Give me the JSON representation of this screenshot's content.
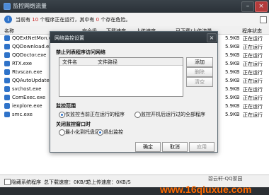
{
  "window": {
    "title": "监控网络流量"
  },
  "infobar": {
    "prefix": "当前有",
    "count_running": "10",
    "middle": "个程序正在运行，其中有",
    "count_danger": "0",
    "suffix": "个存在危险。"
  },
  "table": {
    "headers": [
      "名称",
      "安全级",
      "下载速度",
      "上传速度",
      "已下载/上传流量",
      "程序状态"
    ],
    "rows": [
      {
        "name": "QQExtNetMon.exe",
        "traffic": "5.9KB",
        "status": "正在运行"
      },
      {
        "name": "QQDownload.exe",
        "traffic": "5.9KB",
        "status": "正在运行"
      },
      {
        "name": "QQDoctor.exe",
        "traffic": "5.9KB",
        "status": "正在运行"
      },
      {
        "name": "RTX.exe",
        "traffic": "5.9KB",
        "status": "正在运行"
      },
      {
        "name": "Rtvscan.exe",
        "traffic": "5.9KB",
        "status": "正在运行"
      },
      {
        "name": "QQAutoUpdate.exe",
        "traffic": "5.9KB",
        "status": "正在运行"
      },
      {
        "name": "svchost.exe",
        "traffic": "5.9KB",
        "status": "正在运行"
      },
      {
        "name": "ComExec.exe",
        "traffic": "5.9KB",
        "status": "正在运行"
      },
      {
        "name": "iexplore.exe",
        "traffic": "5.9KB",
        "status": "正在运行"
      },
      {
        "name": "smc.exe",
        "traffic": "5.9KB",
        "status": "正在运行"
      }
    ]
  },
  "footer": {
    "hide_label": "隐藏系统程序",
    "download_speed": "总下载速度：0KB/S",
    "upload_speed": "总上传速度：0KB/S"
  },
  "dialog": {
    "title": "网络监控设置",
    "section_forbidden": "禁止列表程序访问网络",
    "list_headers": [
      "文件名",
      "文件路径"
    ],
    "buttons": {
      "add": "添加",
      "delete": "删除",
      "clear": "清空"
    },
    "section_scope": "监控范围",
    "scope_opt1": "仅监控当前正在运行的程序",
    "scope_opt2": "监控开机后运行过的全部程序",
    "section_close": "关闭监控窗口时",
    "close_opt1": "最小化到托盘区",
    "close_opt2": "退出监控",
    "footer_buttons": {
      "ok": "确定",
      "cancel": "取消",
      "apply": "应用"
    }
  },
  "watermark": {
    "line1": "碧云轩-QQ家园",
    "line2": "www.16qiuxue.com"
  },
  "colors": {
    "titlebar": "#2f363c",
    "accent": "#2f73c9",
    "alert": "#c81f1f",
    "watermark": "#ff6a00"
  }
}
